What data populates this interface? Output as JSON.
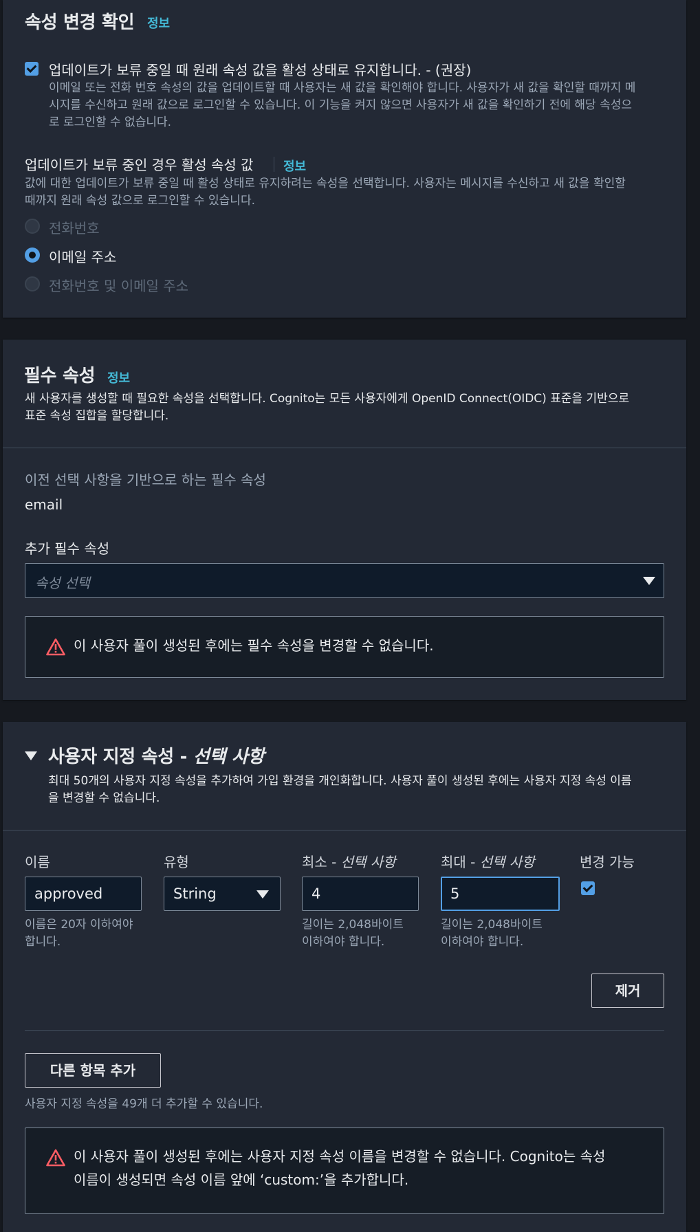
{
  "confirm_section": {
    "title": "속성 변경 확인",
    "info_link": "정보",
    "keep_original": {
      "checked": true,
      "label": "업데이트가 보류 중일 때 원래 속성 값을 활성 상태로 유지합니다. - (권장)",
      "description_line1": "이메일 또는 전화 번호 속성의 값을 업데이트할 때 사용자는 새 값을 확인해야 합니다. 사용자가 새 값을 확인할 때까지 메",
      "description_line2": "시지를 수신하고 원래 값으로 로그인할 수 있습니다. 이 기능을 켜지 않으면 사용자가 새 값을 확인하기 전에 해당 속성으",
      "description_line3": "로 로그인할 수 없습니다."
    },
    "active_value": {
      "title": "업데이트가 보류 중인 경우 활성 속성 값",
      "info_link": "정보",
      "description_line1": "값에 대한 업데이트가 보류 중일 때 활성 상태로 유지하려는 속성을 선택합니다. 사용자는 메시지를 수신하고 새 값을 확인할",
      "description_line2": "때까지 원래 속성 값으로 로그인할 수 있습니다.",
      "options": [
        {
          "label": "전화번호",
          "selected": false,
          "disabled": true
        },
        {
          "label": "이메일 주소",
          "selected": true,
          "disabled": false
        },
        {
          "label": "전화번호 및 이메일 주소",
          "selected": false,
          "disabled": true
        }
      ]
    }
  },
  "required_section": {
    "title": "필수 속성",
    "info_link": "정보",
    "description_line1": "새 사용자를 생성할 때 필요한 속성을 선택합니다. Cognito는 모든 사용자에게 OpenID Connect(OIDC) 표준을 기반으로",
    "description_line2": "표준 속성 집합을 할당합니다.",
    "based_on_label": "이전 선택 사항을 기반으로 하는 필수 속성",
    "based_on_value": "email",
    "additional_label": "추가 필수 속성",
    "select_placeholder": "속성 선택",
    "alert": "이 사용자 풀이 생성된 후에는 필수 속성을 변경할 수 없습니다."
  },
  "custom_section": {
    "title_main": "사용자 지정 속성 - ",
    "title_optional": "선택 사항",
    "description_line1": "최대 50개의 사용자 지정 속성을 추가하여 가입 환경을 개인화합니다. 사용자 풀이 생성된 후에는 사용자 지정 속성 이름",
    "description_line2": "을 변경할 수 없습니다.",
    "columns": {
      "name": "이름",
      "type": "유형",
      "min_prefix": "최소 - ",
      "max_prefix": "최대 - ",
      "optional": "선택 사항",
      "mutable": "변경 가능"
    },
    "row": {
      "name_value": "approved",
      "name_hint_line1": "이름은 20자 이하여야",
      "name_hint_line2": "합니다.",
      "type_value": "String",
      "min_value": "4",
      "min_hint_line1": "길이는 2,048바이트",
      "min_hint_line2": "이하여야 합니다.",
      "max_value": "5",
      "max_hint_line1": "길이는 2,048바이트",
      "max_hint_line2": "이하여야 합니다.",
      "mutable_checked": true
    },
    "remove_button": "제거",
    "add_button": "다른 항목 추가",
    "remaining_text": "사용자 지정 속성을 49개 더 추가할 수 있습니다.",
    "alert_line1": "이 사용자 풀이 생성된 후에는 사용자 지정 속성 이름을 변경할 수 없습니다. Cognito는 속성",
    "alert_line2": "이름이 생성되면 속성 이름 앞에 ‘custom:’을 추가합니다."
  },
  "colors": {
    "accent": "#539fe5",
    "info_link": "#44b9d6",
    "warning": "#ff5d64"
  }
}
